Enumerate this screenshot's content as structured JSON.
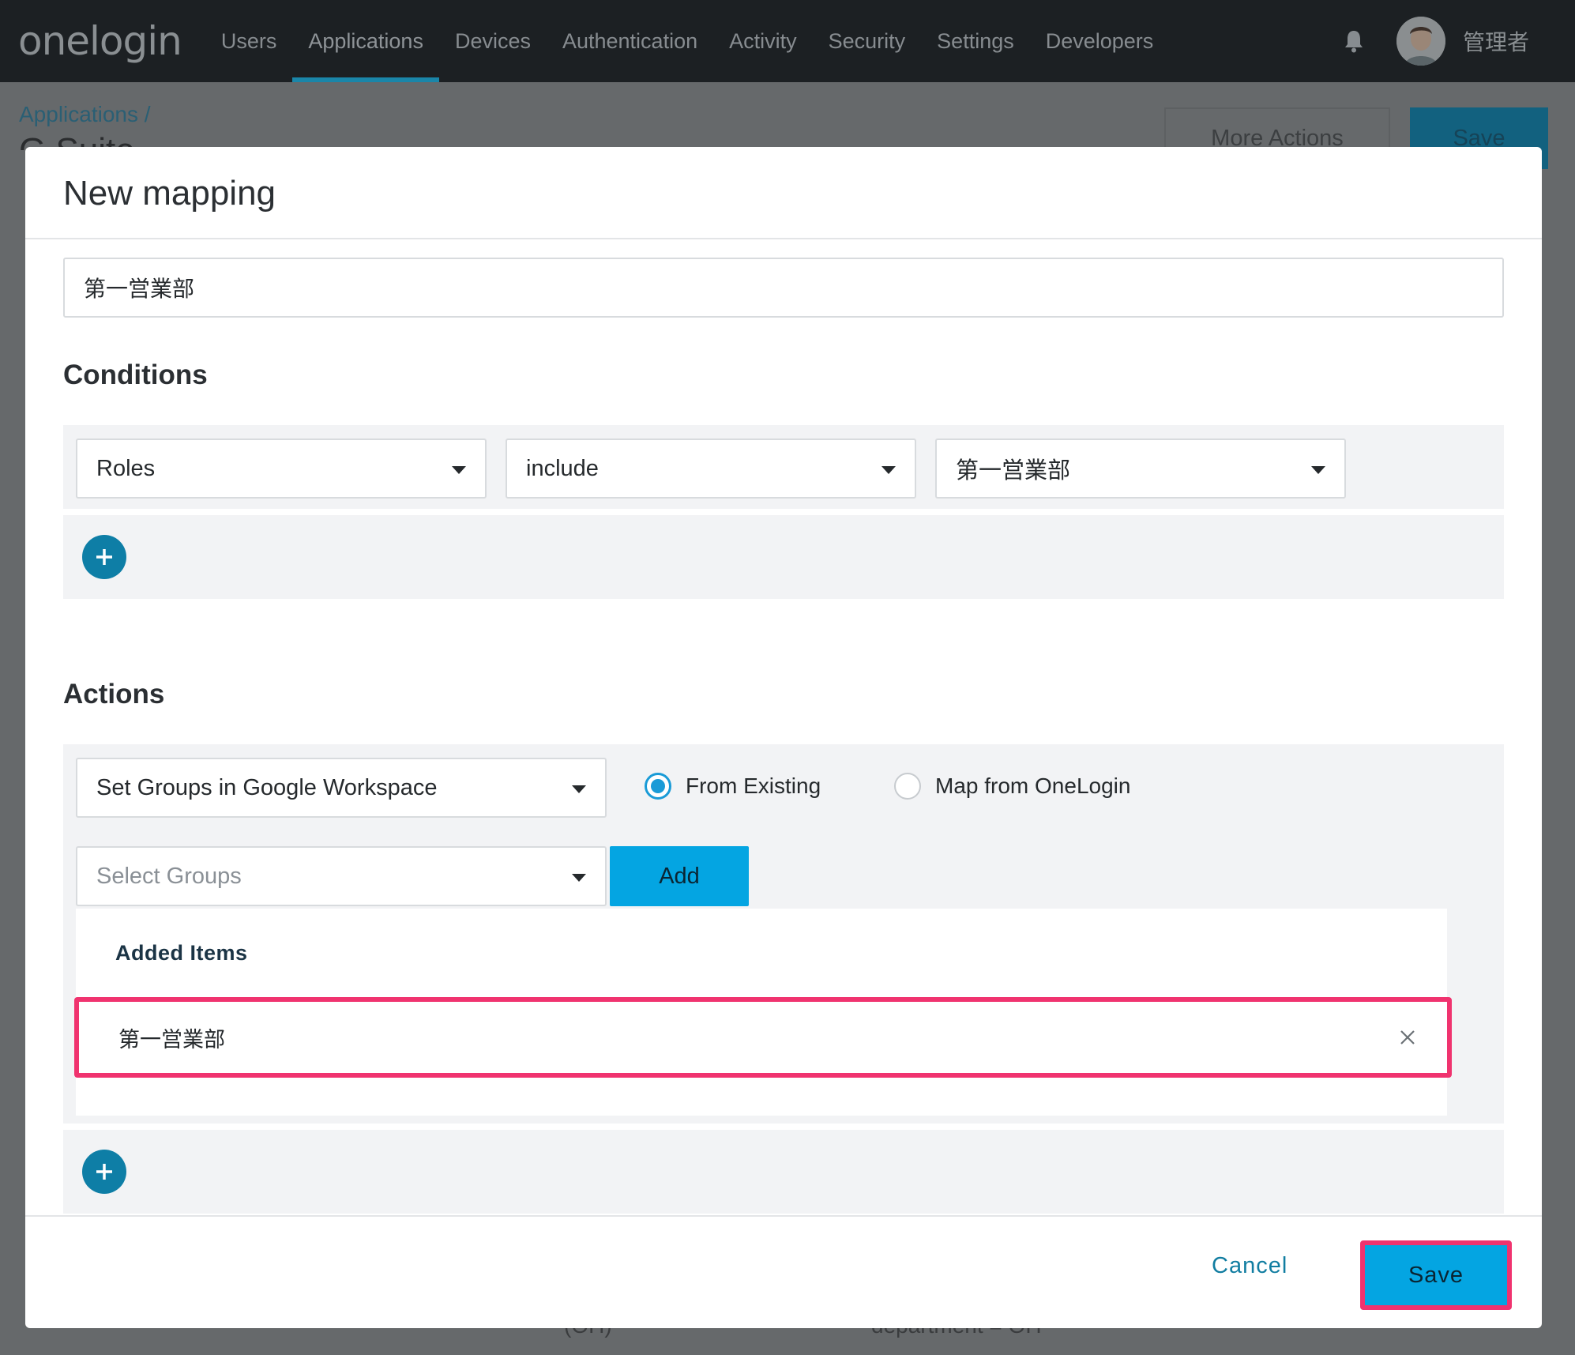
{
  "topnav": {
    "logo": "onelogin",
    "items": [
      {
        "label": "Users"
      },
      {
        "label": "Applications"
      },
      {
        "label": "Devices"
      },
      {
        "label": "Authentication"
      },
      {
        "label": "Activity"
      },
      {
        "label": "Security"
      },
      {
        "label": "Settings"
      },
      {
        "label": "Developers"
      }
    ],
    "active_item": "Applications",
    "username": "管理者"
  },
  "page": {
    "breadcrumb": "Applications /",
    "title": "G Suite",
    "more_actions_label": "More Actions",
    "save_label": "Save",
    "footer_text_left": "(OH)",
    "footer_text_right": "department = OH"
  },
  "modal": {
    "title": "New mapping",
    "name_value": "第一営業部",
    "conditions": {
      "heading": "Conditions",
      "field": "Roles",
      "operator": "include",
      "value": "第一営業部"
    },
    "actions": {
      "heading": "Actions",
      "action": "Set Groups in Google Workspace",
      "radio_from_existing": "From Existing",
      "radio_map_from_onelogin": "Map from OneLogin",
      "selected_radio": "From Existing",
      "select_groups_placeholder": "Select Groups",
      "add_label": "Add",
      "added_items_title": "Added Items",
      "added_items": [
        "第一営業部"
      ]
    },
    "cancel_label": "Cancel",
    "save_label": "Save"
  },
  "colors": {
    "accent": "#04a5e2",
    "plus_button": "#0e7ea6",
    "highlight": "#f0336f",
    "nav_bg": "#1c2023"
  }
}
